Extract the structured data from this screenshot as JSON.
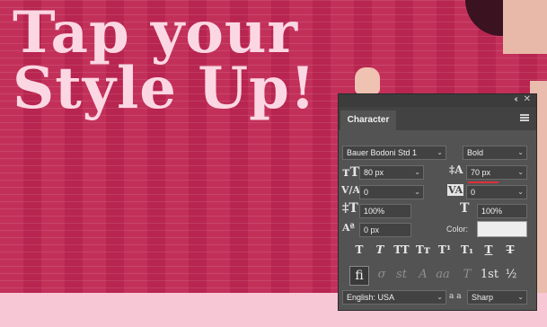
{
  "canvas": {
    "headline_line1": "Tap your",
    "headline_line2": "Style Up!"
  },
  "panel": {
    "collapse_label": "‹‹",
    "close_label": "✕",
    "tab_label": "Character",
    "font_family": "Bauer Bodoni Std 1",
    "font_style": "Bold",
    "font_size": "80 px",
    "leading": "70 px",
    "kerning": "0",
    "tracking": "0",
    "vertical_scale": "100%",
    "horizontal_scale": "100%",
    "baseline_shift": "0 px",
    "color_label": "Color:",
    "language": "English: USA",
    "antialias_icon_label": "a a",
    "antialias": "Sharp",
    "style_buttons": [
      "T",
      "T",
      "TT",
      "Tт",
      "T¹",
      "T₁",
      "T",
      "T"
    ],
    "opentype_buttons": [
      "fi",
      "σ",
      "st",
      "A",
      "aa",
      "T",
      "1st",
      "½"
    ]
  },
  "colors": {
    "background": "#c02a52",
    "headline": "#fbd7e3",
    "panel": "#535353",
    "accent": "#e0303a"
  }
}
